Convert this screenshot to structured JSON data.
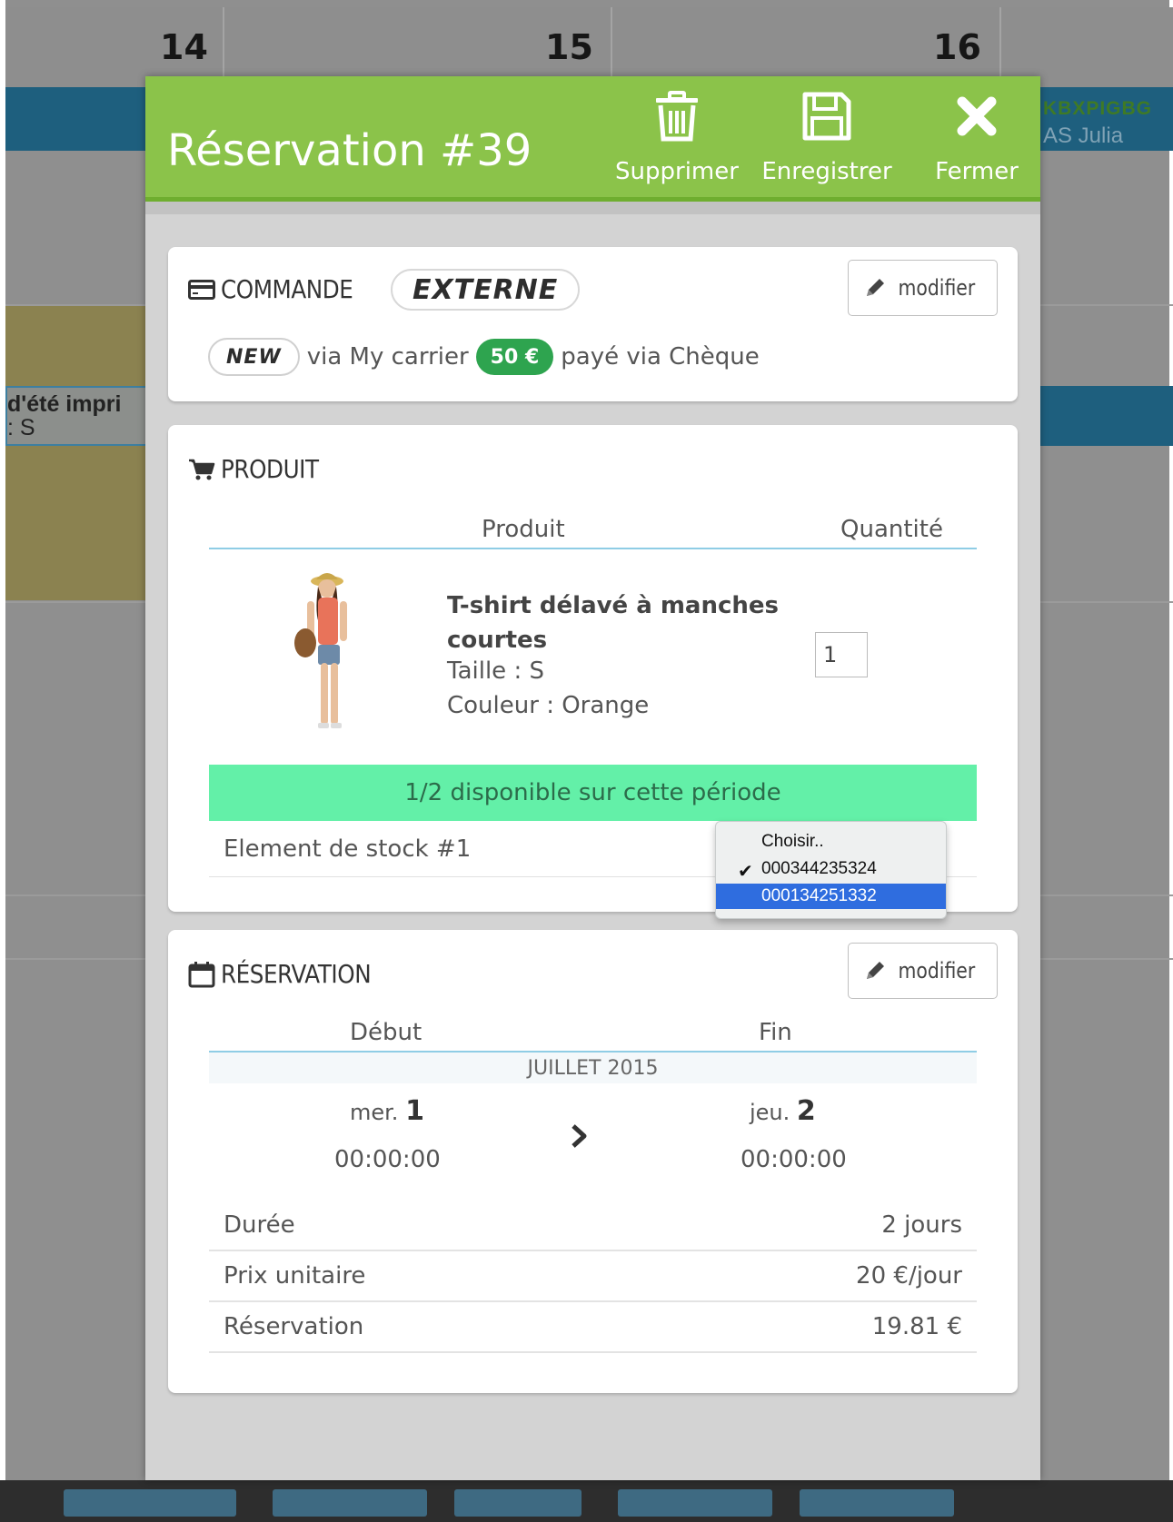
{
  "calendar": {
    "days": [
      "14",
      "15",
      "16"
    ],
    "events": {
      "left_title": "d'été impri",
      "left_sub": ": S",
      "right_code": "KBXPIGBG",
      "right_name": "AS Julia"
    }
  },
  "modal": {
    "title": "Réservation #39",
    "actions": {
      "delete": {
        "label": "Supprimer",
        "icon": "trash-icon"
      },
      "save": {
        "label": "Enregistrer",
        "icon": "floppy-disk-icon"
      },
      "close": {
        "label": "Fermer",
        "icon": "close-icon"
      }
    }
  },
  "order": {
    "title": "COMMANDE",
    "type_badge": "EXTERNE",
    "edit_label": "modifier",
    "status_badge": "NEW",
    "carrier_text": "via My carrier",
    "price_badge": "50 €",
    "payment_text": "payé via Chèque"
  },
  "product": {
    "title": "PRODUIT",
    "col_product": "Produit",
    "col_quantity": "Quantité",
    "name": "T-shirt délavé à manches courtes",
    "size": "Taille : S",
    "color": "Couleur : Orange",
    "quantity": "1",
    "availability": "1/2 disponible sur cette période",
    "stock_label": "Element de stock #1",
    "stock_options": [
      "Choisir..",
      "000344235324",
      "000134251332"
    ],
    "stock_checked": "000344235324",
    "stock_highlighted": "000134251332"
  },
  "reservation": {
    "title": "RÉSERVATION",
    "edit_label": "modifier",
    "col_start": "Début",
    "col_end": "Fin",
    "month": "JUILLET 2015",
    "start_dow": "mer.",
    "start_day": "1",
    "start_time": "00:00:00",
    "end_dow": "jeu.",
    "end_day": "2",
    "end_time": "00:00:00",
    "rows": [
      {
        "label": "Durée",
        "value": "2 jours"
      },
      {
        "label": "Prix unitaire",
        "value": "20 €/jour"
      },
      {
        "label": "Réservation",
        "value": "19.81 €"
      }
    ]
  },
  "colors": {
    "header_green": "#8bc34a",
    "availability_green": "#63f0a8",
    "price_badge": "#2ea44f",
    "table_rule": "#8fcde5",
    "select_highlight": "#2f6ddf"
  }
}
